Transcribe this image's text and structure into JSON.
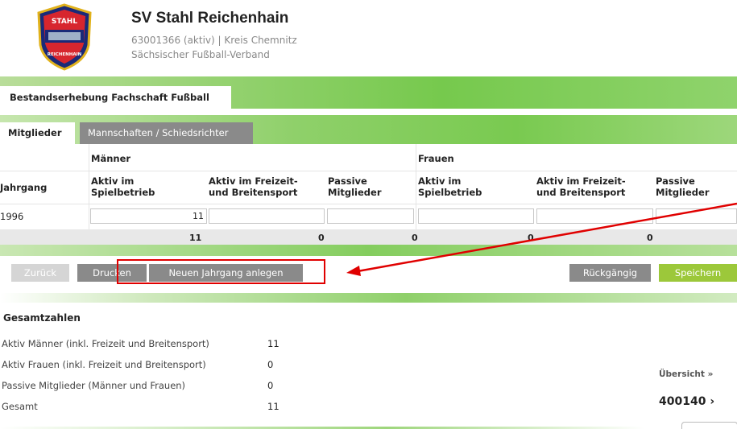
{
  "club": {
    "name": "SV Stahl Reichenhain",
    "subline1": "63001366 (aktiv) | Kreis Chemnitz",
    "subline2": "Sächsischer Fußball-Verband",
    "logo_top_text": "STAHL",
    "logo_bottom_text": "REICHENHAIN"
  },
  "section_tab": "Bestandserhebung Fachschaft Fußball",
  "tabs": [
    {
      "label": "Mitglieder",
      "active": true
    },
    {
      "label": "Mannschaften / Schiedsrichter",
      "active": false
    }
  ],
  "table": {
    "group_men": "Männer",
    "group_women": "Frauen",
    "col_year": "Jahrgang",
    "col_active": "Aktiv im Spielbetrieb",
    "col_active_line1": "Aktiv im",
    "col_active_line2": "Spielbetrieb",
    "col_leisure_line1": "Aktiv im Freizeit-",
    "col_leisure_line2": "und Breitensport",
    "col_passive_line1": "Passive",
    "col_passive_line2": "Mitglieder",
    "rows": [
      {
        "year": "1996",
        "men_active": "11",
        "men_leisure": "",
        "men_passive": "",
        "women_active": "",
        "women_leisure": "",
        "women_passive": ""
      }
    ],
    "sums": {
      "men_active": "11",
      "men_leisure": "0",
      "men_passive": "0",
      "women_active": "0",
      "women_leisure": "0"
    }
  },
  "buttons": {
    "back": "Zurück",
    "print": "Drucken",
    "new_year": "Neuen Jahrgang anlegen",
    "undo": "Rückgängig",
    "save": "Speichern"
  },
  "totals": {
    "title": "Gesamtzahlen",
    "rows": [
      {
        "label": "Aktiv Männer (inkl. Freizeit und Breitensport)",
        "value": "11"
      },
      {
        "label": "Aktiv Frauen (inkl. Freizeit und Breitensport)",
        "value": "0"
      },
      {
        "label": "Passive Mitglieder (Männer und Frauen)",
        "value": "0"
      },
      {
        "label": "Gesamt",
        "value": "11"
      }
    ]
  },
  "sidebar": {
    "link": "Übersicht »",
    "number": "400140 ›"
  },
  "colors": {
    "brand_green": "#79ca50",
    "save_green": "#9cc83a",
    "button_gray": "#8a8a8a",
    "annotation_red": "#e00000"
  }
}
